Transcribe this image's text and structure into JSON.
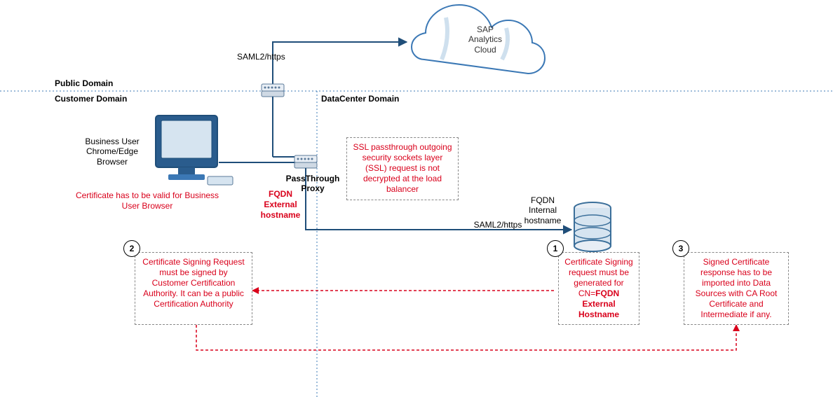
{
  "domains": {
    "public": "Public Domain",
    "customer": "Customer Domain",
    "datacenter": "DataCenter Domain"
  },
  "cloud": {
    "line1": "SAP",
    "line2": "Analytics",
    "line3": "Cloud"
  },
  "browser": {
    "line1": "Business User",
    "line2": "Chrome/Edge",
    "line3": "Browser",
    "cert_note": "Certificate has to be valid for Business User Browser"
  },
  "proxy": {
    "fqdn_label": "FQDN External hostname",
    "name_line1": "PassThrough",
    "name_line2": "Proxy"
  },
  "ssl_note": "SSL passthrough outgoing security sockets layer (SSL) request is not decrypted at the load balancer",
  "db": {
    "line1": "FQDN",
    "line2": "Internal",
    "line3": "hostname"
  },
  "connections": {
    "saml_top": "SAML2/https",
    "saml_right": "SAML2/https"
  },
  "steps": {
    "s1": {
      "num": "1",
      "text_prefix": "Certificate Signing request must be generated for CN=",
      "text_bold": "FQDN External Hostname"
    },
    "s2": {
      "num": "2",
      "text": "Certificate Signing Request must be signed by Customer Certification Authority. It can be a public Certification Authority"
    },
    "s3": {
      "num": "3",
      "text": "Signed Certificate response has to be imported into Data Sources with CA Root Certificate and Intermediate if any."
    }
  }
}
